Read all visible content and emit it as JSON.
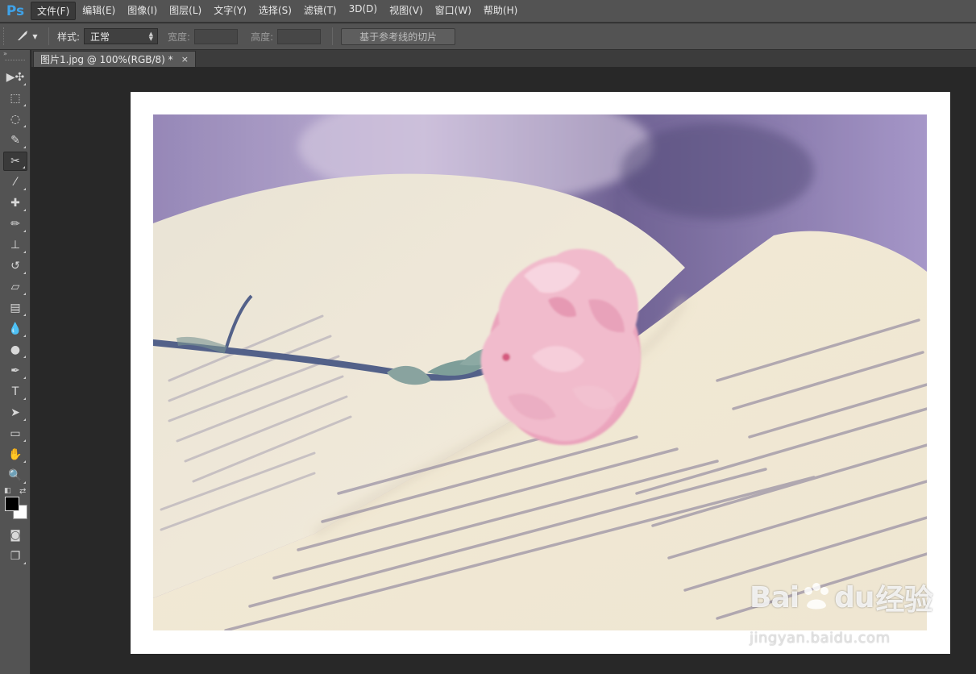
{
  "app": {
    "logo": "Ps"
  },
  "menu": [
    {
      "label": "文件(F)",
      "active": true
    },
    {
      "label": "编辑(E)"
    },
    {
      "label": "图像(I)"
    },
    {
      "label": "图层(L)"
    },
    {
      "label": "文字(Y)"
    },
    {
      "label": "选择(S)"
    },
    {
      "label": "滤镜(T)"
    },
    {
      "label": "3D(D)"
    },
    {
      "label": "视图(V)"
    },
    {
      "label": "窗口(W)"
    },
    {
      "label": "帮助(H)"
    }
  ],
  "options": {
    "style_label": "样式:",
    "style_value": "正常",
    "width_label": "宽度:",
    "height_label": "高度:",
    "slice_button": "基于参考线的切片"
  },
  "document": {
    "tab_title": "图片1.jpg @ 100%(RGB/8) *",
    "close": "×"
  },
  "toolbar": {
    "collapse": "»",
    "tools": [
      {
        "name": "move-tool-icon",
        "glyph": "▶✣"
      },
      {
        "name": "marquee-tool-icon",
        "glyph": "⬚"
      },
      {
        "name": "lasso-tool-icon",
        "glyph": "◌"
      },
      {
        "name": "quick-select-tool-icon",
        "glyph": "✎"
      },
      {
        "name": "slice-tool-icon",
        "glyph": "✂",
        "active": true
      },
      {
        "name": "eyedropper-tool-icon",
        "glyph": "⁄"
      },
      {
        "name": "healing-brush-tool-icon",
        "glyph": "✚"
      },
      {
        "name": "brush-tool-icon",
        "glyph": "✏"
      },
      {
        "name": "clone-stamp-tool-icon",
        "glyph": "⊥"
      },
      {
        "name": "history-brush-tool-icon",
        "glyph": "↺"
      },
      {
        "name": "eraser-tool-icon",
        "glyph": "▱"
      },
      {
        "name": "gradient-tool-icon",
        "glyph": "▤"
      },
      {
        "name": "blur-tool-icon",
        "glyph": "💧"
      },
      {
        "name": "dodge-tool-icon",
        "glyph": "●"
      },
      {
        "name": "pen-tool-icon",
        "glyph": "✒"
      },
      {
        "name": "type-tool-icon",
        "glyph": "T"
      },
      {
        "name": "path-select-tool-icon",
        "glyph": "➤"
      },
      {
        "name": "rectangle-tool-icon",
        "glyph": "▭"
      },
      {
        "name": "hand-tool-icon",
        "glyph": "✋"
      },
      {
        "name": "zoom-tool-icon",
        "glyph": "🔍"
      }
    ],
    "quick_mask": "◙",
    "screen_mode": "❐"
  },
  "colors": {
    "foreground": "#000000",
    "background": "#ffffff"
  },
  "watermark": {
    "brand_left": "Bai",
    "brand_mid": "du",
    "brand_right": "经验",
    "url": "jingyan.baidu.com"
  }
}
